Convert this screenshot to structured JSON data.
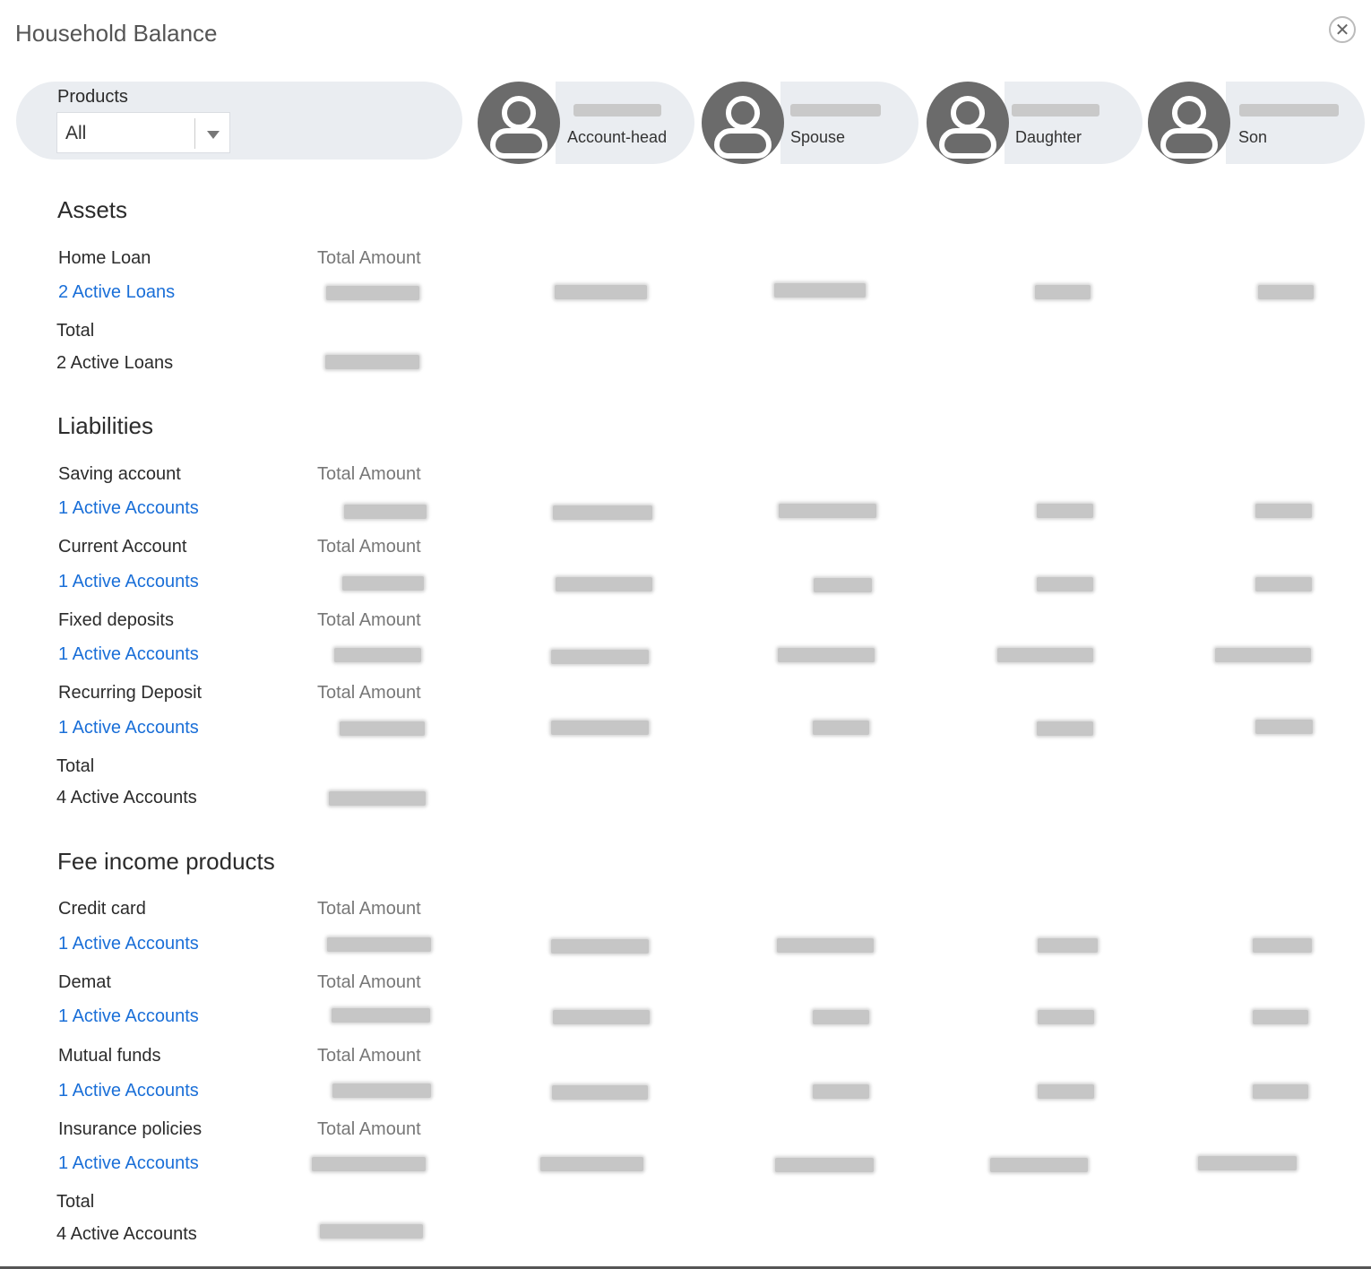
{
  "header": {
    "title": "Household Balance"
  },
  "filter": {
    "label": "Products",
    "value": "All"
  },
  "members": [
    {
      "role": "Account-head"
    },
    {
      "role": "Spouse"
    },
    {
      "role": "Daughter"
    },
    {
      "role": "Son"
    }
  ],
  "column_header": "Total Amount",
  "assets": {
    "title": "Assets",
    "rows": [
      {
        "label": "Home Loan",
        "link": "2 Active Loans"
      }
    ],
    "total_label": "Total",
    "total_value": "2 Active Loans"
  },
  "liabilities": {
    "title": "Liabilities",
    "rows": [
      {
        "label": "Saving account",
        "link": "1 Active Accounts"
      },
      {
        "label": "Current Account",
        "link": "1 Active Accounts"
      },
      {
        "label": "Fixed deposits",
        "link": "1 Active Accounts"
      },
      {
        "label": "Recurring Deposit",
        "link": "1 Active Accounts"
      }
    ],
    "total_label": "Total",
    "total_value": "4 Active Accounts"
  },
  "fee_income": {
    "title": "Fee income products",
    "rows": [
      {
        "label": "Credit card",
        "link": "1 Active Accounts"
      },
      {
        "label": "Demat",
        "link": "1 Active Accounts"
      },
      {
        "label": "Mutual funds",
        "link": "1 Active Accounts"
      },
      {
        "label": "Insurance policies",
        "link": "1 Active Accounts"
      }
    ],
    "total_label": "Total",
    "total_value": "4 Active Accounts"
  }
}
